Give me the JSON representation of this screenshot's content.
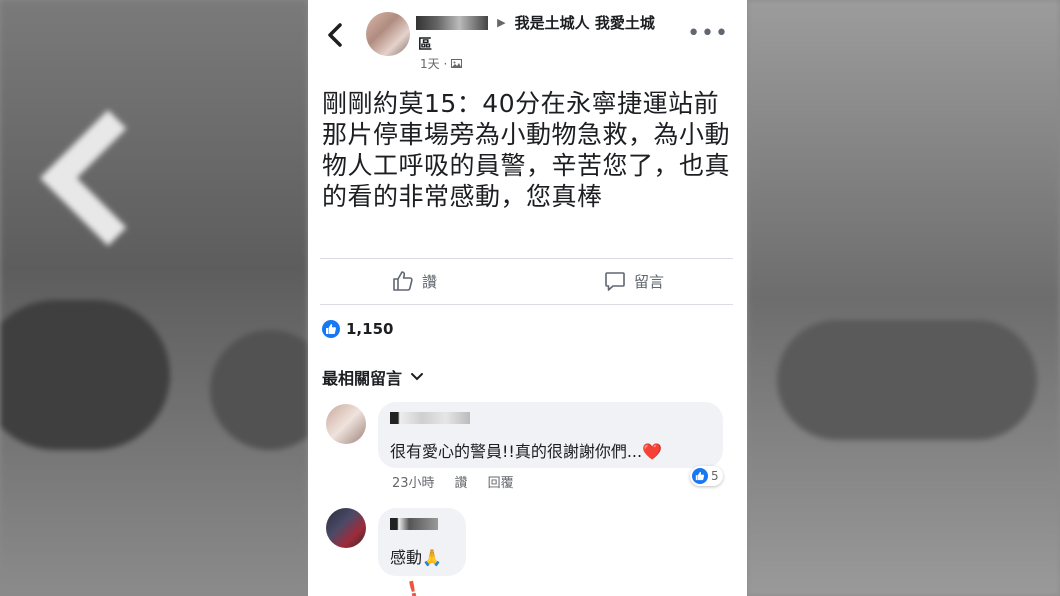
{
  "post": {
    "group_line1": "我是土城人 我愛土城",
    "group_line2": "區",
    "meta_time": "1天 ·",
    "text": "剛剛約莫15：40分在永寧捷運站前那片停車場旁為小動物急救，為小動物人工呼吸的員警，辛苦您了，也真的看的非常感動，您真棒"
  },
  "actions": {
    "like_label": "讚",
    "comment_label": "留言"
  },
  "reactions": {
    "count": "1,150"
  },
  "comments_section": {
    "sort_label": "最相關留言",
    "comments": [
      {
        "text": "很有愛心的警員!!真的很謝謝你們...",
        "emoji": "❤️",
        "time": "23小時",
        "like_label": "讚",
        "reply_label": "回覆",
        "reaction_count": "5"
      },
      {
        "text": "感動🙏"
      }
    ]
  },
  "colors": {
    "facebook_blue": "#1877f2",
    "text_primary": "#1c1e21",
    "text_secondary": "#65676b",
    "bubble_bg": "#f0f2f5"
  }
}
